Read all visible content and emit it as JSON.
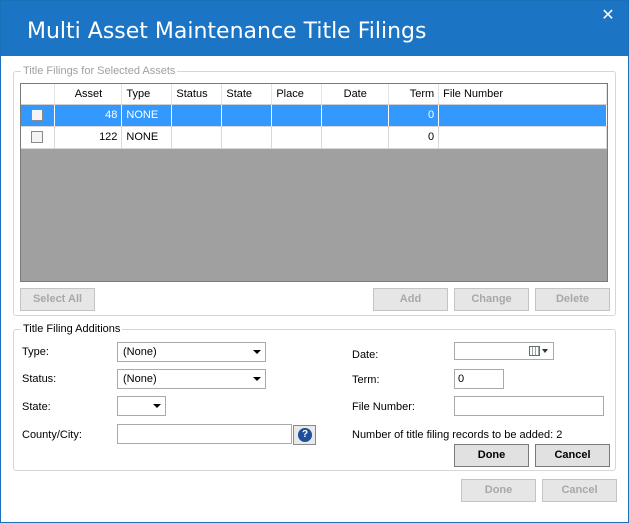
{
  "window": {
    "title": "Multi Asset Maintenance Title Filings",
    "close_glyph": "✕"
  },
  "filings_group": {
    "legend": "Title Filings for Selected Assets",
    "columns": [
      "",
      "Asset",
      "Type",
      "Status",
      "State",
      "Place",
      "Date",
      "Term",
      "File Number"
    ],
    "rows": [
      {
        "asset": "48",
        "type": "NONE",
        "status": "",
        "state": "",
        "place": "",
        "date": "",
        "term": "0",
        "file_number": "",
        "selected": true
      },
      {
        "asset": "122",
        "type": "NONE",
        "status": "",
        "state": "",
        "place": "",
        "date": "",
        "term": "0",
        "file_number": "",
        "selected": false
      }
    ],
    "buttons": {
      "select_all": "Select All",
      "add": "Add",
      "change": "Change",
      "delete": "Delete"
    }
  },
  "additions_group": {
    "legend": "Title Filing Additions",
    "type_label": "Type:",
    "type_value": "(None)",
    "status_label": "Status:",
    "status_value": "(None)",
    "state_label": "State:",
    "state_value": "",
    "county_label": "County/City:",
    "county_value": "",
    "date_label": "Date:",
    "date_value": "",
    "term_label": "Term:",
    "term_value": "0",
    "file_number_label": "File Number:",
    "file_number_value": "",
    "records_count_text": "Number of title filing records to be added: 2",
    "done_label": "Done",
    "cancel_label": "Cancel"
  },
  "footer": {
    "done_label": "Done",
    "cancel_label": "Cancel"
  },
  "icons": {
    "help": "?"
  }
}
